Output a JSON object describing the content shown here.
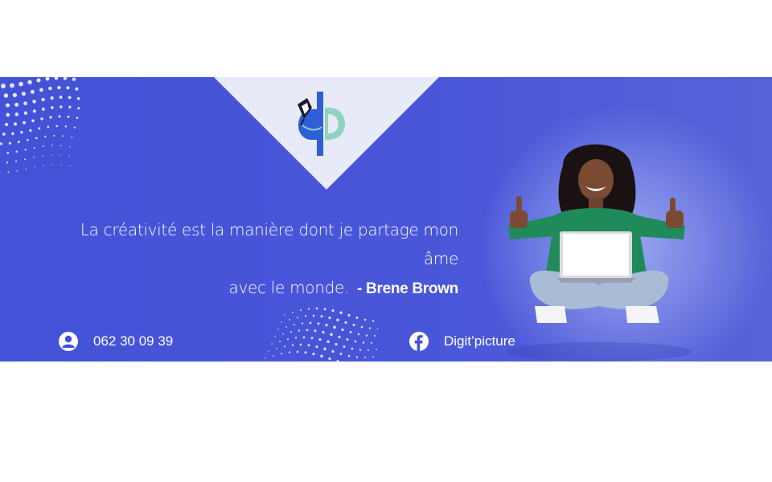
{
  "brand": {
    "logo_letters": "dp"
  },
  "quote": {
    "line1": "La créativité est la manière dont je partage mon âme",
    "line2": "avec le monde.",
    "author": "- Brene Brown"
  },
  "contacts": {
    "phone": {
      "icon": "user-circle-icon",
      "text": "062 30 09 39"
    },
    "facebook": {
      "icon": "facebook-icon",
      "text": "Digit’picture"
    }
  },
  "colors": {
    "banner": "#4352d8",
    "triangle": "#e8eaf8",
    "logo_blue": "#2f5fd6",
    "logo_teal": "#8fd3c0"
  }
}
